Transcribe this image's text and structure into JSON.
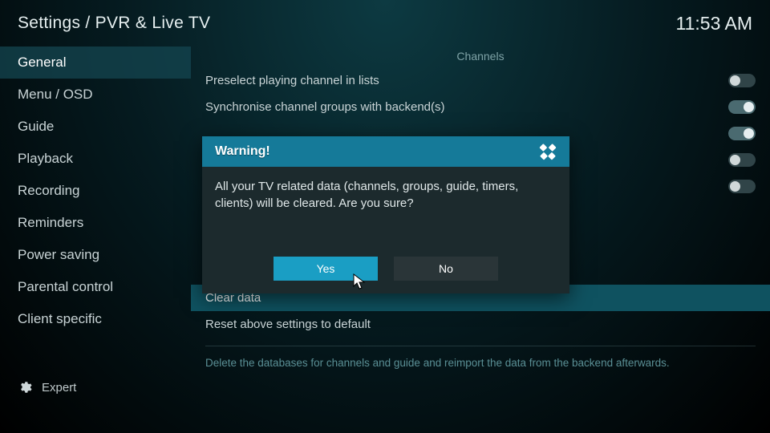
{
  "header": {
    "title": "Settings / PVR & Live TV",
    "clock": "11:53 AM"
  },
  "sidebar": {
    "items": [
      {
        "label": "General",
        "selected": true
      },
      {
        "label": "Menu / OSD"
      },
      {
        "label": "Guide"
      },
      {
        "label": "Playback"
      },
      {
        "label": "Recording"
      },
      {
        "label": "Reminders"
      },
      {
        "label": "Power saving"
      },
      {
        "label": "Parental control"
      },
      {
        "label": "Client specific"
      }
    ],
    "level_label": "Expert"
  },
  "content": {
    "section": "Channels",
    "rows": [
      {
        "label": "Preselect playing channel in lists",
        "toggle": "off"
      },
      {
        "label": "Synchronise channel groups with backend(s)",
        "toggle": "on"
      },
      {
        "label": "",
        "toggle": "on"
      },
      {
        "label": "",
        "toggle": "off"
      },
      {
        "label": "",
        "toggle": "off"
      }
    ],
    "clear_data": "Clear data",
    "reset_default": "Reset above settings to default",
    "help": "Delete the databases for channels and guide and reimport the data from the backend afterwards."
  },
  "dialog": {
    "title": "Warning!",
    "message": "All your TV related data (channels, groups, guide, timers, clients) will be cleared. Are you sure?",
    "yes": "Yes",
    "no": "No"
  }
}
